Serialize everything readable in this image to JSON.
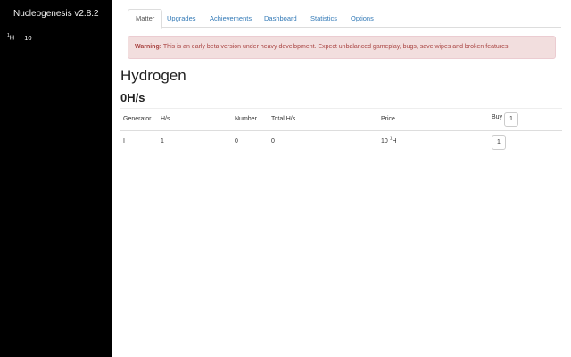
{
  "sidebar": {
    "title": "Nucleogenesis v2.8.2",
    "resource": {
      "mass_number": "1",
      "symbol": "H",
      "count": "10"
    }
  },
  "tabs": [
    {
      "label": "Matter",
      "active": true
    },
    {
      "label": "Upgrades"
    },
    {
      "label": "Achievements"
    },
    {
      "label": "Dashboard"
    },
    {
      "label": "Statistics"
    },
    {
      "label": "Options"
    }
  ],
  "alert": {
    "prefix": "Warning:",
    "message": " This is an early beta version under heavy development. Expect unbalanced gameplay, bugs, save wipes and broken features."
  },
  "main": {
    "heading": "Hydrogen",
    "rate": "0H/s"
  },
  "table": {
    "headers": {
      "generator": "Generator",
      "hs": "H/s",
      "number": "Number",
      "total_hs": "Total H/s",
      "price": "Price",
      "buy": "Buy",
      "buy_amount": "1"
    },
    "rows": [
      {
        "generator": "I",
        "hs": "1",
        "number": "0",
        "total_hs": "0",
        "price_value": "10",
        "price_mass_number": "1",
        "price_symbol": "H",
        "buy_button": "1"
      }
    ]
  }
}
